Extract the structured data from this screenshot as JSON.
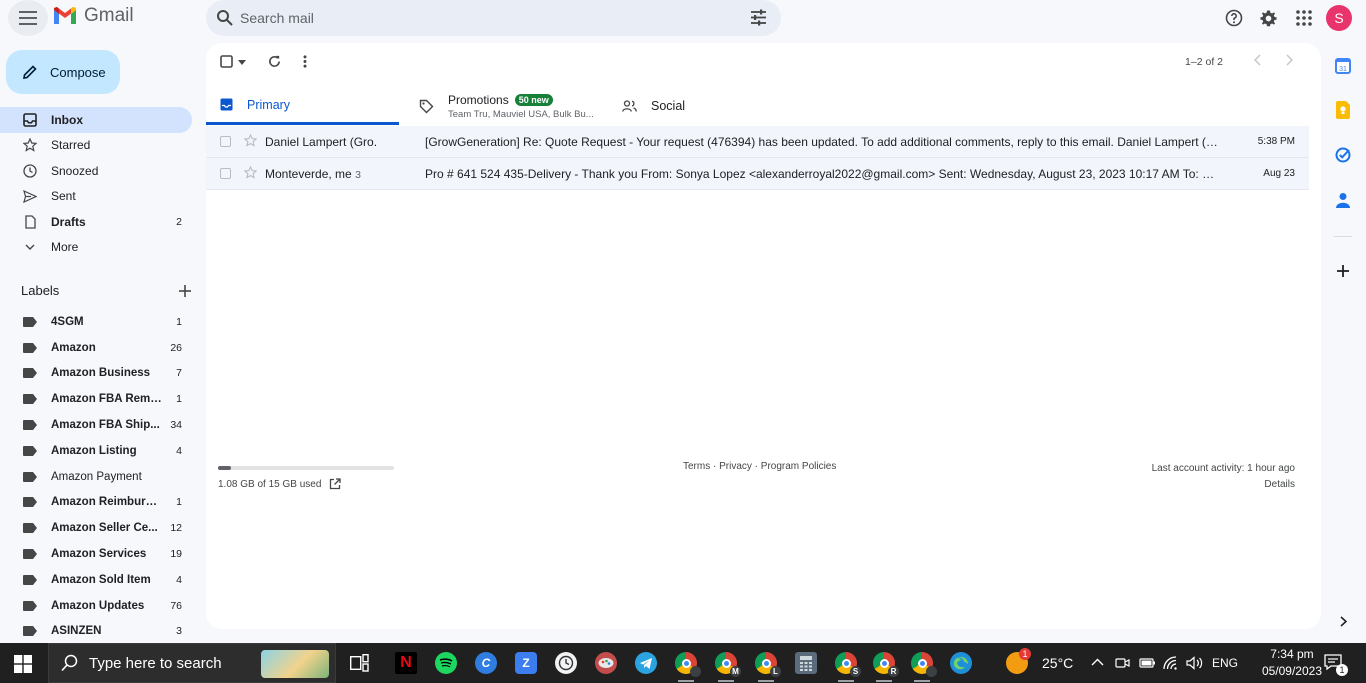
{
  "header": {
    "app_name": "Gmail",
    "search_placeholder": "Search mail",
    "avatar_letter": "S"
  },
  "compose": {
    "label": "Compose"
  },
  "nav": [
    {
      "label": "Inbox",
      "count": "",
      "icon": "inbox-icon",
      "active": true,
      "bold": true
    },
    {
      "label": "Starred",
      "count": "",
      "icon": "star-icon",
      "active": false,
      "bold": false
    },
    {
      "label": "Snoozed",
      "count": "",
      "icon": "clock-icon",
      "active": false,
      "bold": false
    },
    {
      "label": "Sent",
      "count": "",
      "icon": "send-icon",
      "active": false,
      "bold": false
    },
    {
      "label": "Drafts",
      "count": "2",
      "icon": "draft-icon",
      "active": false,
      "bold": true
    },
    {
      "label": "More",
      "count": "",
      "icon": "chevron-down-icon",
      "active": false,
      "bold": false
    }
  ],
  "labels_heading": "Labels",
  "labels": [
    {
      "name": "4SGM",
      "count": "1",
      "bold": true
    },
    {
      "name": "Amazon",
      "count": "26",
      "bold": true
    },
    {
      "name": "Amazon Business",
      "count": "7",
      "bold": true
    },
    {
      "name": "Amazon FBA Remo...",
      "count": "1",
      "bold": true
    },
    {
      "name": "Amazon FBA Ship...",
      "count": "34",
      "bold": true
    },
    {
      "name": "Amazon Listing",
      "count": "4",
      "bold": true
    },
    {
      "name": "Amazon Payment",
      "count": "",
      "bold": false
    },
    {
      "name": "Amazon Reimburse...",
      "count": "1",
      "bold": true
    },
    {
      "name": "Amazon Seller Ce...",
      "count": "12",
      "bold": true
    },
    {
      "name": "Amazon Services",
      "count": "19",
      "bold": true
    },
    {
      "name": "Amazon Sold Item",
      "count": "4",
      "bold": true
    },
    {
      "name": "Amazon Updates",
      "count": "76",
      "bold": true
    },
    {
      "name": "ASINZEN",
      "count": "3",
      "bold": true
    }
  ],
  "toolbar": {
    "pager": "1–2 of 2"
  },
  "tabs": {
    "primary": "Primary",
    "promotions": "Promotions",
    "promotions_badge": "50 new",
    "promotions_sub": "Team Tru, Mauviel USA, Bulk Bu...",
    "social": "Social"
  },
  "emails": [
    {
      "sender": "Daniel Lampert (Gro.",
      "thread_count": "",
      "subject": "[GrowGeneration] Re: Quote Request - Your request (476394) has been updated. To add additional comments, reply to this email. Daniel Lampert (GrowGe...",
      "date": "5:38 PM"
    },
    {
      "sender": "Monteverde, me",
      "thread_count": "3",
      "subject": "Pro # 641 524 435-Delivery - Thank you From: Sonya Lopez <alexanderroyal2022@gmail.com> Sent: Wednesday, August 23, 2023 10:17 AM To: Monteverde ...",
      "date": "Aug 23"
    }
  ],
  "footer": {
    "storage_text": "1.08 GB of 15 GB used",
    "storage_fraction": 0.072,
    "links": "Terms · Privacy · Program Policies",
    "activity": "Last account activity: 1 hour ago",
    "details": "Details"
  },
  "taskbar": {
    "search_placeholder": "Type here to search",
    "weather_temp": "25°C",
    "weather_badge": "1",
    "language": "ENG",
    "time": "7:34 pm",
    "date": "05/09/2023",
    "notif_count": "1",
    "chrome_profiles": [
      "",
      "M",
      "L",
      "S",
      "R",
      ""
    ]
  }
}
